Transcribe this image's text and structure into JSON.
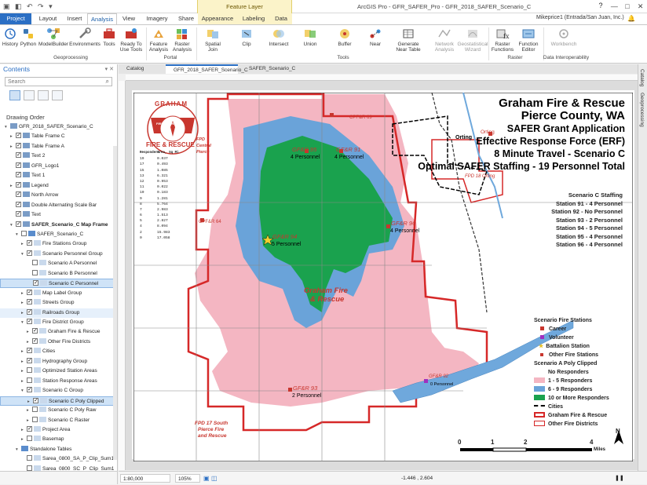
{
  "app": {
    "window_title": "ArcGIS Pro - GFR_SAFER_Pro - GFR_2018_SAFER_Scenario_C",
    "context_group": "Feature Layer",
    "user": "Mikeprice1 (Entrada/San Juan, Inc.)",
    "help": "?",
    "minimize": "—",
    "maximize": "□",
    "close": "✕",
    "quick_access": "▣ ◧ ↶ ↷ ▾"
  },
  "tabs": [
    "Project",
    "Layout",
    "Insert",
    "Analysis",
    "View",
    "Imagery",
    "Share",
    "Appearance",
    "Labeling",
    "Data"
  ],
  "ribbon": {
    "buttons": {
      "history": "History",
      "python": "Python",
      "modelbuilder": "ModelBuilder",
      "environments": "Environments",
      "tools": "Tools",
      "ready_to_use_1": "Ready To",
      "ready_to_use_2": "Use Tools",
      "feature_analysis_1": "Feature",
      "feature_analysis_2": "Analysis",
      "raster_analysis_1": "Raster",
      "raster_analysis_2": "Analysis",
      "spatial_join_1": "Spatial",
      "spatial_join_2": "Join",
      "clip": "Clip",
      "intersect": "Intersect",
      "union": "Union",
      "buffer": "Buffer",
      "near": "Near",
      "gen_near_1": "Generate",
      "gen_near_2": "Near Table",
      "network_analysis_1": "Network",
      "network_analysis_2": "Analysis",
      "geostat_1": "Geostatistical",
      "geostat_2": "Wizard",
      "raster_functions_1": "Raster",
      "raster_functions_2": "Functions",
      "function_editor_1": "Function",
      "function_editor_2": "Editor",
      "workbench": "Workbench"
    },
    "groups": {
      "geoprocessing": "Geoprocessing",
      "portal": "Portal",
      "tools": "Tools",
      "raster": "Raster",
      "data_interop": "Data Interoperability"
    }
  },
  "contents": {
    "title": "Contents",
    "search_placeholder": "Search",
    "drawing_order": "Drawing Order",
    "items": [
      {
        "label": "GFR_2018_SAFER_Scenario_C",
        "level": 0,
        "expand": "▾",
        "check": false,
        "bold": false
      },
      {
        "label": "Table Frame C",
        "level": 1,
        "expand": "▸",
        "check": true
      },
      {
        "label": "Table Frame A",
        "level": 1,
        "expand": "▸",
        "check": true
      },
      {
        "label": "Text 2",
        "level": 1,
        "expand": "",
        "check": true
      },
      {
        "label": "GFR_Logo1",
        "level": 1,
        "expand": "",
        "check": true
      },
      {
        "label": "Text 1",
        "level": 1,
        "expand": "",
        "check": true
      },
      {
        "label": "Legend",
        "level": 1,
        "expand": "▸",
        "check": true
      },
      {
        "label": "North Arrow",
        "level": 1,
        "expand": "",
        "check": true
      },
      {
        "label": "Double Alternating Scale Bar",
        "level": 1,
        "expand": "",
        "check": true
      },
      {
        "label": "Text",
        "level": 1,
        "expand": "",
        "check": true
      },
      {
        "label": "SAFER_Scenario_C Map Frame",
        "level": 1,
        "expand": "▾",
        "check": true,
        "bold": true
      },
      {
        "label": "SAFER_Scenario_C",
        "level": 2,
        "expand": "▾",
        "check": false
      },
      {
        "label": "Fire Stations Group",
        "level": 3,
        "expand": "▸",
        "check": true
      },
      {
        "label": "Scenario Personnel Group",
        "level": 3,
        "expand": "▾",
        "check": true
      },
      {
        "label": "Scenario A Personnel",
        "level": 4,
        "expand": "",
        "check": false
      },
      {
        "label": "Scenario B Personnel",
        "level": 4,
        "expand": "",
        "check": false
      },
      {
        "label": "Scenario C Personnel",
        "level": 4,
        "expand": "",
        "check": true,
        "selected": true
      },
      {
        "label": "Map Label Group",
        "level": 3,
        "expand": "▸",
        "check": true
      },
      {
        "label": "Streets Group",
        "level": 3,
        "expand": "▸",
        "check": true
      },
      {
        "label": "Railroads Group",
        "level": 3,
        "expand": "▸",
        "check": true,
        "highlight": true
      },
      {
        "label": "Fire District Group",
        "level": 3,
        "expand": "▾",
        "check": true
      },
      {
        "label": "Graham Fire & Rescue",
        "level": 4,
        "expand": "▸",
        "check": true
      },
      {
        "label": "Other Fire Districts",
        "level": 4,
        "expand": "▸",
        "check": true
      },
      {
        "label": "Cities",
        "level": 3,
        "expand": "▸",
        "check": true
      },
      {
        "label": "Hydrography Group",
        "level": 3,
        "expand": "▸",
        "check": true
      },
      {
        "label": "Optimized Station Areas",
        "level": 3,
        "expand": "▸",
        "check": false
      },
      {
        "label": "Station Response Areas",
        "level": 3,
        "expand": "▸",
        "check": false
      },
      {
        "label": "Scenario C Group",
        "level": 3,
        "expand": "▾",
        "check": true
      },
      {
        "label": "Scenario C Poly Clipped",
        "level": 4,
        "expand": "▸",
        "check": true,
        "selected": true
      },
      {
        "label": "Scenario C Poly Raw",
        "level": 4,
        "expand": "▸",
        "check": false
      },
      {
        "label": "Scenario C Raster",
        "level": 4,
        "expand": "▸",
        "check": false
      },
      {
        "label": "Project Area",
        "level": 3,
        "expand": "▸",
        "check": true
      },
      {
        "label": "Basemap",
        "level": 3,
        "expand": "▸",
        "check": false
      },
      {
        "label": "Standalone Tables",
        "level": 2,
        "expand": "▾",
        "check": false
      },
      {
        "label": "Sarea_0800_SA_P_Clip_Sum1",
        "level": 3,
        "expand": "",
        "check": false
      },
      {
        "label": "Sarea_0800_SC_P_Clip_Sum1",
        "level": 3,
        "expand": "",
        "check": false
      }
    ]
  },
  "doc_tabs": [
    "Catalog",
    "GFR_2018_SAFER_Scenario_C",
    "SAFER_Scenario_C"
  ],
  "side_panes": [
    "Catalog",
    "Geoprocessing"
  ],
  "map": {
    "title_lines": [
      "Graham Fire & Rescue",
      "Pierce County, WA",
      "SAFER Grant Application",
      "Effective Response Force (ERF)",
      "8 Minute Travel - Scenario C",
      "Optimal SAFER Staffing - 19 Personnel Total"
    ],
    "staffing_lines": [
      "Scenario C Staffing",
      "Station 91 - 4 Personnel",
      "Station 92 - No Personnel",
      "Station 93 - 2 Personnel",
      "Station 94 - 5 Personnel",
      "Station 95 - 4 Personnel",
      "Station 96 - 4 Personnel"
    ],
    "labels": {
      "cpfr69": "CPF&R 69",
      "orting1": "Orting",
      "orting2": "Orting",
      "fpd18": "FPD 18 Orting",
      "gfr95": "GF&R 95",
      "gfr95p": "4 Personnel",
      "gfr91": "GF&R 91",
      "gfr91p": "4 Personnel",
      "gfr96": "GF&R 96",
      "gfr96p": "4 Personnel",
      "gfr94": "GF&R 94",
      "gfr94p": "5 Personnel",
      "gfr93": "GF&R 93",
      "gfr93p": "2 Personnel",
      "gfr92": "GF&R 92",
      "gfr92p": "0 Personnel",
      "cpfr64": "CPF&R 64",
      "central1": "FPD",
      "central2": "Central",
      "central3": "Pierce",
      "district": "Graham Fire",
      "district2": "& Rescue",
      "fpd17a": "FPD 17 South",
      "fpd17b": "Pierce Fire",
      "fpd17c": "and Rescue"
    },
    "logo": {
      "top": "GRAHAM",
      "ring": "FIRE DISTRICT 21",
      "bottom": "FIRE & RESCUE"
    },
    "response_table": {
      "header": [
        "Responders",
        "Area, Sq Mi"
      ],
      "rows": [
        [
          "19",
          "0.037"
        ],
        [
          "17",
          "0.493"
        ],
        [
          "15",
          "1.085"
        ],
        [
          "13",
          "6.321"
        ],
        [
          "12",
          "0.953"
        ],
        [
          "11",
          "0.022"
        ],
        [
          "10",
          "0.183"
        ],
        [
          "9",
          "1.281"
        ],
        [
          "8",
          "5.764"
        ],
        [
          "7",
          "2.983"
        ],
        [
          "6",
          "1.513"
        ],
        [
          "5",
          "2.827"
        ],
        [
          "4",
          "8.094"
        ],
        [
          "2",
          "15.983"
        ],
        [
          "0",
          "17.058"
        ]
      ]
    },
    "legend": {
      "title1": "Scenario Fire Stations",
      "career": "Career",
      "volunteer": "Volunteer",
      "battalion": "Battalion Station",
      "other_stations": "Other Fire Stations",
      "title2": "Scenario A Poly Clipped",
      "no_resp": "No Responders",
      "r1": "1 - 5 Responders",
      "r2": "6 - 9 Responders",
      "r3": "10 or More Responders",
      "cities": "Cities",
      "gfr": "Graham Fire & Rescue",
      "other_districts": "Other Fire Districts"
    },
    "scale": {
      "ticks": [
        "0",
        "1",
        "2",
        "4"
      ],
      "unit": "Miles"
    },
    "north": "N"
  },
  "status": {
    "scale": "1:80,000",
    "zoom": "105%",
    "coords": "-1.446 , 2.604",
    "pause": "❚❚"
  },
  "colors": {
    "accent": "#2b6fc4",
    "green_fill": "#1aa24e",
    "blue_fill": "#6aa3d9",
    "pink_fill": "#f4b6c2",
    "boundary": "#d62828"
  }
}
